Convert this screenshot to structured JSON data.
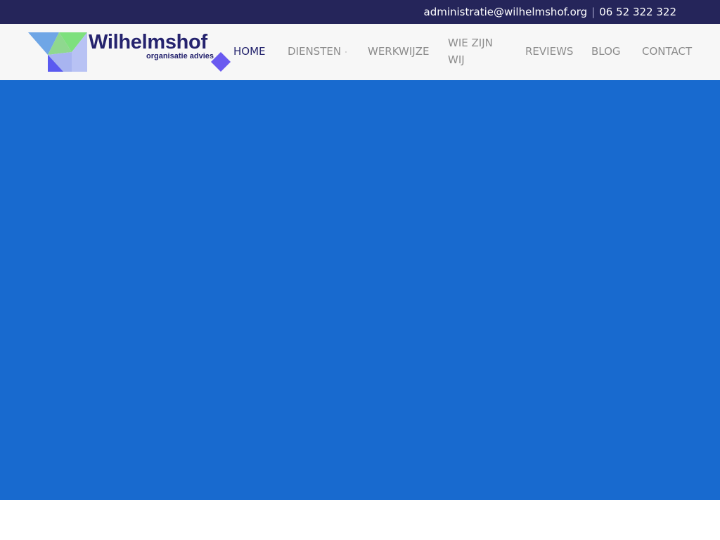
{
  "topbar": {
    "email": "administratie@wilhelmshof.org",
    "separator": "|",
    "phone": "06 52 322 322"
  },
  "logo": {
    "brand": "Wilhelmshof",
    "tagline": "organisatie advies",
    "colors": {
      "navy": "#25236e",
      "green": "#7ee07e",
      "blue": "#6fa6e6",
      "purple": "#5a5af0",
      "lavender": "#a8b4f0"
    }
  },
  "nav": {
    "items": [
      {
        "label": "HOME",
        "active": true
      },
      {
        "label": "DIENSTEN",
        "has_dropdown": true
      },
      {
        "label": "WERKWIJZE"
      },
      {
        "label": "WIE ZIJN WIJ"
      },
      {
        "label": "REVIEWS"
      },
      {
        "label": "BLOG"
      },
      {
        "label": "CONTACT"
      }
    ]
  },
  "colors": {
    "topbar_bg": "#25255a",
    "header_bg": "#f7f7f7",
    "hero_bg": "#186acf",
    "nav_active": "#25256e",
    "nav_text": "#8c8c8c"
  }
}
